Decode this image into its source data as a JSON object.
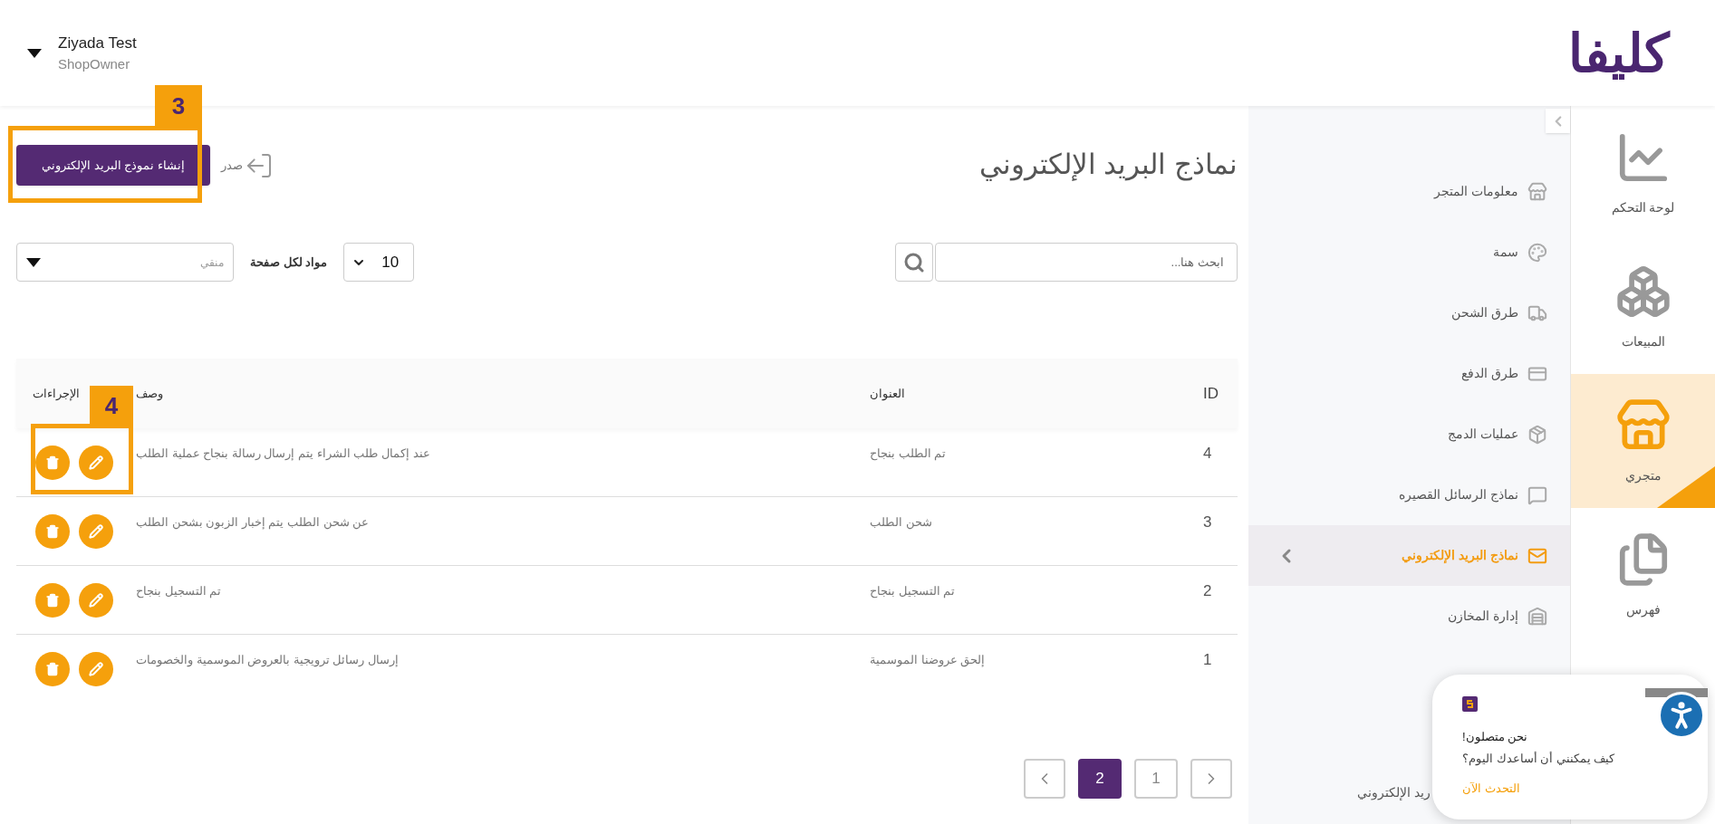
{
  "header": {
    "user_name": "Ziyada Test",
    "user_role": "ShopOwner",
    "logo_text": "كليفا"
  },
  "rail": [
    {
      "label": "لوحة التحكم",
      "selected": false
    },
    {
      "label": "المبيعات",
      "selected": false
    },
    {
      "label": "متجري",
      "selected": true
    },
    {
      "label": "فهرس",
      "selected": false
    }
  ],
  "submenu": {
    "items": [
      {
        "label": "معلومات المتجر",
        "selected": false
      },
      {
        "label": "سمة",
        "selected": false
      },
      {
        "label": "طرق الشحن",
        "selected": false
      },
      {
        "label": "طرق الدفع",
        "selected": false
      },
      {
        "label": "عمليات الدمج",
        "selected": false
      },
      {
        "label": "نماذج الرسائل القصيره",
        "selected": false
      },
      {
        "label": "نماذج البريد الإلكتروني",
        "selected": true
      },
      {
        "label": "إدارة المخازن",
        "selected": false
      }
    ],
    "partial_item": "ريد الإلكتروني"
  },
  "page": {
    "title": "نماذج البريد الإلكتروني",
    "export_label": "صدر",
    "create_button": "إنشاء نموذج البريد الإلكتروني",
    "search": {
      "placeholder": "ابحث هنا..."
    },
    "filter": {
      "placeholder": "منقي"
    },
    "page_size": {
      "label": "مواد لكل صفحة",
      "value": "10"
    }
  },
  "table": {
    "columns": [
      "ID",
      "العنوان",
      "وصف",
      "الإجراءات"
    ],
    "rows": [
      {
        "id": "4",
        "title": "تم الطلب بنجاح",
        "description": "عند إكمال طلب الشراء يتم إرسال رسالة بنجاح عملية الطلب"
      },
      {
        "id": "3",
        "title": "شحن الطلب",
        "description": "عن شحن الطلب يتم إخبار الزبون بشحن الطلب"
      },
      {
        "id": "2",
        "title": "تم التسجيل بنجاح",
        "description": "تم التسجيل بنجاح"
      },
      {
        "id": "1",
        "title": "إلحق عروضنا الموسمية",
        "description": "إرسال رسائل ترويجية بالعروض الموسمية والخصومات"
      }
    ]
  },
  "pagination": {
    "pages": [
      {
        "label": "1",
        "selected": false
      },
      {
        "label": "2",
        "selected": true
      }
    ]
  },
  "chat": {
    "status": "نحن متصلون!",
    "question": "كيف يمكنني أن أساعدك اليوم؟",
    "link": "التحدث الآن"
  },
  "callouts": [
    {
      "label": "3"
    },
    {
      "label": "4"
    }
  ]
}
